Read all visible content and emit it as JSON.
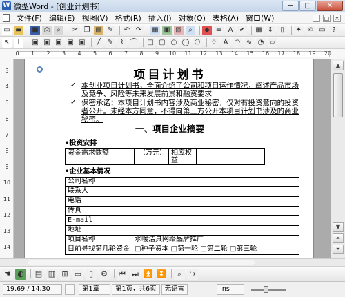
{
  "window": {
    "app_icon": "W",
    "title": "微型Word - [创业计划书]",
    "buttons": [
      "─",
      "□",
      "✕"
    ]
  },
  "menubar": {
    "items": [
      "文件(F)",
      "编辑(E)",
      "视图(V)",
      "格式(R)",
      "插入(I)",
      "对象(O)",
      "表格(A)",
      "窗口(W)"
    ],
    "right_buttons": [
      "_",
      "□",
      "×"
    ]
  },
  "toolbar_standard": [
    {
      "icon": "new-doc-icon",
      "glyph": "▭",
      "color": "#ffffff"
    },
    {
      "icon": "open-folder-icon",
      "glyph": "▬",
      "color": "#e8c25a"
    },
    {
      "icon": "save-icon",
      "glyph": "■",
      "color": "#3a5ea8"
    },
    {
      "icon": "print-icon",
      "glyph": "⎙",
      "color": "#d8d8d8"
    },
    {
      "icon": "print-preview-icon",
      "glyph": "⌕",
      "color": "#d8d8d8"
    },
    {
      "icon": "cut-icon",
      "glyph": "✂",
      "color": "#f0f0f0"
    },
    {
      "icon": "copy-icon",
      "glyph": "❐",
      "color": "#f0f0f0"
    },
    {
      "icon": "paste-icon",
      "glyph": "▤",
      "color": "#d9b46a"
    },
    {
      "icon": "format-painter-icon",
      "glyph": "✎",
      "color": "#f0f0f0"
    },
    {
      "icon": "undo-icon",
      "glyph": "↶",
      "color": "#f0f0f0"
    },
    {
      "icon": "redo-icon",
      "glyph": "↷",
      "color": "#f0f0f0"
    },
    {
      "icon": "table-icon",
      "glyph": "▦",
      "color": "#cfe0f5"
    },
    {
      "icon": "insert-image-icon",
      "glyph": "▣",
      "color": "#9cc79a"
    },
    {
      "icon": "insert-object-icon",
      "glyph": "▧",
      "color": "#e7b7b7"
    },
    {
      "icon": "zoom-icon",
      "glyph": "⌕",
      "color": "#cfe0f5"
    },
    {
      "icon": "color-picker-icon",
      "glyph": "◆",
      "color": "#e05050"
    },
    {
      "icon": "columns-icon",
      "glyph": "≡",
      "color": "#f0f0f0"
    },
    {
      "icon": "text-frame-icon",
      "glyph": "A",
      "color": "#f0f0f0"
    },
    {
      "icon": "spell-check-icon",
      "glyph": "✔",
      "color": "#f0f0f0"
    },
    {
      "icon": "grid-icon",
      "glyph": "▦",
      "color": "#f0f0f0"
    },
    {
      "icon": "text-direction-icon",
      "glyph": "⇕",
      "color": "#f0f0f0"
    },
    {
      "icon": "page-setup-icon",
      "glyph": "▯",
      "color": "#f0f0f0"
    },
    {
      "icon": "wizard-icon",
      "glyph": "✦",
      "color": "#f0f0f0"
    },
    {
      "icon": "sign-icon",
      "glyph": "✍",
      "color": "#f0f0f0"
    },
    {
      "icon": "window-icon",
      "glyph": "▭",
      "color": "#f0f0f0"
    },
    {
      "icon": "help-icon",
      "glyph": "?",
      "color": "#f0f0f0"
    }
  ],
  "toolbar_drawing": [
    {
      "icon": "select-arrow-icon",
      "glyph": "↖",
      "color": "#ffffff"
    },
    {
      "icon": "text-cursor-icon",
      "glyph": "I",
      "color": "#ffffff"
    },
    {
      "icon": "picture-frame-icon",
      "glyph": "▣",
      "color": "#f0f0f0"
    },
    {
      "icon": "picture-frame-2-icon",
      "glyph": "▣",
      "color": "#f0f0f0"
    },
    {
      "icon": "picture-frame-3-icon",
      "glyph": "▣",
      "color": "#f0f0f0"
    },
    {
      "icon": "picture-frame-4-icon",
      "glyph": "▣",
      "color": "#f0f0f0"
    },
    {
      "icon": "picture-frame-5-icon",
      "glyph": "▣",
      "color": "#f0f0f0"
    },
    {
      "icon": "line-icon",
      "glyph": "╱",
      "color": "#f0f0f0"
    },
    {
      "icon": "pencil-icon",
      "glyph": "✎",
      "color": "#f0f0f0"
    },
    {
      "icon": "brush-icon",
      "glyph": "⌇",
      "color": "#f0f0f0"
    },
    {
      "icon": "polyline-icon",
      "glyph": "⌒",
      "color": "#f0f0f0"
    },
    {
      "icon": "rectangle-icon",
      "glyph": "□",
      "color": "#f0f0f0"
    },
    {
      "icon": "rounded-rect-icon",
      "glyph": "▢",
      "color": "#f0f0f0"
    },
    {
      "icon": "ellipse-icon",
      "glyph": "○",
      "color": "#f0f0f0"
    },
    {
      "icon": "circle-icon",
      "glyph": "◯",
      "color": "#f0f0f0"
    },
    {
      "icon": "polygon-icon",
      "glyph": "⬠",
      "color": "#f0f0f0"
    },
    {
      "icon": "star-icon",
      "glyph": "☆",
      "color": "#f0f0f0"
    },
    {
      "icon": "art-text-icon",
      "glyph": "A",
      "color": "#f0f0f0"
    },
    {
      "icon": "arc-icon",
      "glyph": "◠",
      "color": "#f0f0f0"
    },
    {
      "icon": "curve-icon",
      "glyph": "∿",
      "color": "#f0f0f0"
    },
    {
      "icon": "pie-icon",
      "glyph": "◔",
      "color": "#f0f0f0"
    },
    {
      "icon": "callout-icon",
      "glyph": "▱",
      "color": "#f0f0f0"
    }
  ],
  "ruler": {
    "h_numbers": [
      "0",
      "1",
      "2",
      "3",
      "4",
      "5",
      "6",
      "7",
      "8",
      "9",
      "10",
      "11",
      "12",
      "13",
      "14",
      "15",
      "16",
      "17",
      "18",
      "19",
      "20"
    ],
    "v_numbers": [
      "3",
      "4",
      "5",
      "6",
      "7",
      "8",
      "9",
      "10",
      "11",
      "12",
      "13",
      "14"
    ]
  },
  "document": {
    "title": "项目计划书",
    "check_mark": "✓",
    "bullet1": "本创业项目计划书，全面介绍了公司和项目运作情况，阐述产品市场及竞争、风险等未来发展前景和融资要求",
    "bullet2": "保密承诺：本项目计划书内容涉及商业秘密，仅对有投资意向的投资者公开。未经本方同意，不得向第三方公开本项目计划书涉及的商业秘密。",
    "section1": "一、项目企业摘要",
    "sub1": "•投资安排",
    "invest_table": {
      "cells": [
        "资金需求数额",
        "（万元）",
        "相应权益"
      ],
      "sub_cells": [
        "额",
        "元）",
        "益"
      ]
    },
    "sub2": "•企业基本情况",
    "basic_table": [
      {
        "label": "公司名称",
        "value": ""
      },
      {
        "label": "联系人",
        "value": ""
      },
      {
        "label": "电话",
        "value": ""
      },
      {
        "label": "传真",
        "value": ""
      },
      {
        "label": "E-mail",
        "value": ""
      },
      {
        "label": "地址",
        "value": ""
      },
      {
        "label": "项目名称",
        "value": "水暖洁具网络品牌推广"
      },
      {
        "label": "目前寻找第几轮资金",
        "value": "□种子资本 □第一轮 □第二轮 □第三轮"
      }
    ]
  },
  "drawbar": [
    {
      "icon": "hand-tool-icon",
      "glyph": "☚",
      "color": "#f0f0f0"
    },
    {
      "icon": "color-fill-icon",
      "glyph": "◐",
      "color": "#5aa05a"
    },
    {
      "icon": "pages-icon",
      "glyph": "▤",
      "color": "#f0f0f0"
    },
    {
      "icon": "page-view-icon",
      "glyph": "▥",
      "color": "#f0f0f0"
    },
    {
      "icon": "zoom-view-icon",
      "glyph": "⊞",
      "color": "#f0f0f0"
    },
    {
      "icon": "outline-view-icon",
      "glyph": "▭",
      "color": "#f0f0f0"
    },
    {
      "icon": "text-view-icon",
      "glyph": "▯",
      "color": "#f0f0f0"
    },
    {
      "icon": "settings-view-icon",
      "glyph": "⚙",
      "color": "#f0f0f0"
    },
    {
      "icon": "prev-page-icon",
      "glyph": "⏮",
      "color": "#f0f0f0"
    },
    {
      "icon": "next-page-icon",
      "glyph": "⏭",
      "color": "#f0f0f0"
    },
    {
      "icon": "first-page-icon",
      "glyph": "⏫",
      "color": "#f0f0f0"
    },
    {
      "icon": "last-page-icon",
      "glyph": "⏬",
      "color": "#f0f0f0"
    },
    {
      "icon": "find-icon",
      "glyph": "⌕",
      "color": "#f0f0f0"
    },
    {
      "icon": "goto-icon",
      "glyph": "↪",
      "color": "#f0f0f0"
    }
  ],
  "status": {
    "position": "19.69 / 14.30",
    "section": "第1章",
    "pages": "第1页，共6页",
    "language": "无语言",
    "mode": "Ins"
  }
}
